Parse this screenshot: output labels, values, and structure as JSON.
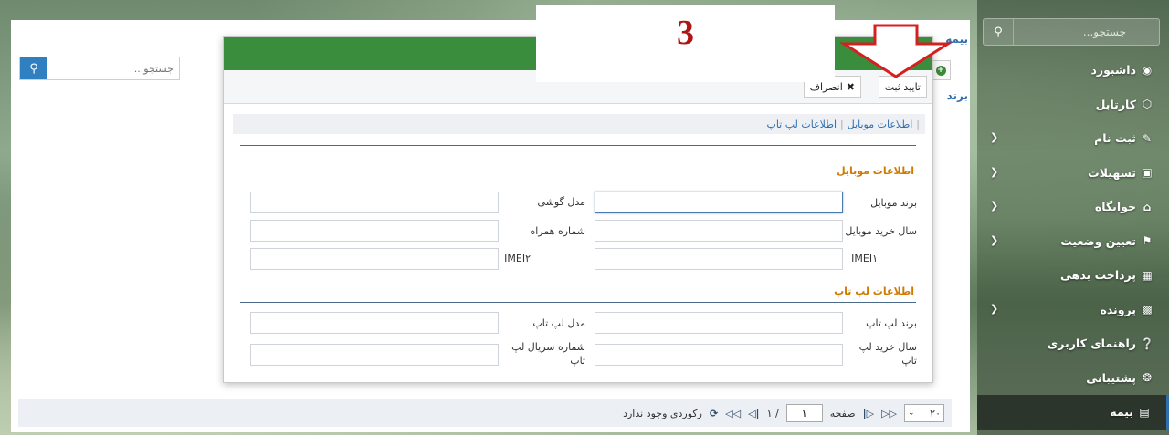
{
  "sidebar": {
    "search_placeholder": "جستجو...",
    "items": [
      {
        "label": "داشبورد",
        "icon": "palette-icon",
        "has_submenu": false
      },
      {
        "label": "کارتابل",
        "icon": "cube-icon",
        "has_submenu": false
      },
      {
        "label": "ثبت نام",
        "icon": "edit-icon",
        "has_submenu": true
      },
      {
        "label": "تسهیلات",
        "icon": "card-icon",
        "has_submenu": true
      },
      {
        "label": "خوابگاه",
        "icon": "home-icon",
        "has_submenu": true
      },
      {
        "label": "تعیین وضعیت",
        "icon": "flag-icon",
        "has_submenu": true
      },
      {
        "label": "پرداخت بدهی",
        "icon": "money-icon",
        "has_submenu": false
      },
      {
        "label": "پرونده",
        "icon": "folder-icon",
        "has_submenu": true
      },
      {
        "label": "راهنمای کاربری",
        "icon": "help-icon",
        "has_submenu": false
      },
      {
        "label": "پشتیبانی",
        "icon": "lifebuoy-icon",
        "has_submenu": false
      },
      {
        "label": "بیمه",
        "icon": "insurance-icon",
        "has_submenu": false,
        "active": true
      }
    ]
  },
  "main": {
    "title": "بیمه",
    "subtitle": "برند",
    "search_placeholder": "جستجو..."
  },
  "modal": {
    "toolbar": {
      "confirm_label": "تایید ثبت",
      "cancel_label": "انصراف"
    },
    "breadcrumbs": [
      "اطلاعات موبایل",
      "اطلاعات لپ تاپ"
    ],
    "mobile_section": {
      "title": "اطلاعات موبایل",
      "fields": {
        "brand": "برند موبایل",
        "model": "مدل گوشی",
        "purchase_year": "سال خرید موبایل",
        "phone_number": "شماره همراه",
        "imei1": "IMEI۱",
        "imei2": "IMEI۲"
      }
    },
    "laptop_section": {
      "title": "اطلاعات لپ تاپ",
      "fields": {
        "brand": "برند لپ تاپ",
        "model": "مدل لپ تاپ",
        "purchase_year": "سال خرید لپ تاپ",
        "serial": "شماره سریال لپ تاپ"
      }
    }
  },
  "pager": {
    "page_size": "۲۰",
    "page_label": "صفحه",
    "page_value": "۱",
    "page_total": "/ ۱",
    "empty_text": "رکوردی وجود ندارد"
  },
  "annotation": {
    "step_number": "3",
    "arrow_color": "#d42020"
  },
  "colors": {
    "header_green": "#3a8d3c",
    "accent_blue": "#2f7fc1",
    "section_orange": "#d17a00"
  }
}
